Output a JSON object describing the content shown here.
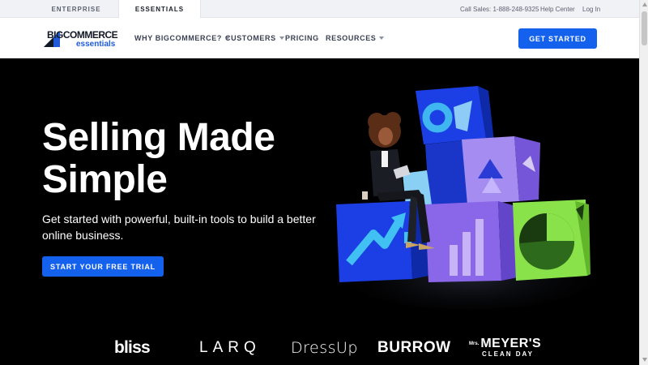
{
  "topbar": {
    "tabs": [
      {
        "label": "ENTERPRISE",
        "active": false
      },
      {
        "label": "ESSENTIALS",
        "active": true
      }
    ],
    "sales": "Call Sales: 1-888-248-9325",
    "help": "Help Center",
    "login": "Log In"
  },
  "nav": {
    "logo_big": "BIGCOMMERCE",
    "logo_sub": "essentials",
    "items": [
      {
        "label": "WHY BIGCOMMERCE?",
        "has_dropdown": true
      },
      {
        "label": "CUSTOMERS",
        "has_dropdown": true
      },
      {
        "label": "PRICING",
        "has_dropdown": false
      },
      {
        "label": "RESOURCES",
        "has_dropdown": true
      }
    ],
    "cta": "GET STARTED"
  },
  "hero": {
    "title_line1": "Selling Made",
    "title_line2": "Simple",
    "subtitle": "Get started with powerful, built-in tools to build a better online business.",
    "cta": "START YOUR FREE TRIAL"
  },
  "brands": {
    "bliss": "bliss",
    "larq": "LARQ",
    "dressup": "DressUp",
    "burrow": "BURROW",
    "meyers_prefix": "Mrs.",
    "meyers_name": "MEYER'S",
    "meyers_tag": "CLEAN DAY"
  },
  "colors": {
    "brand_blue": "#1461ee",
    "hero_bg": "#000000",
    "cube_blue": "#1b3fe4",
    "cube_purple": "#8a66e8",
    "cube_lavender": "#c6b4f6",
    "cube_green": "#89e24a"
  }
}
